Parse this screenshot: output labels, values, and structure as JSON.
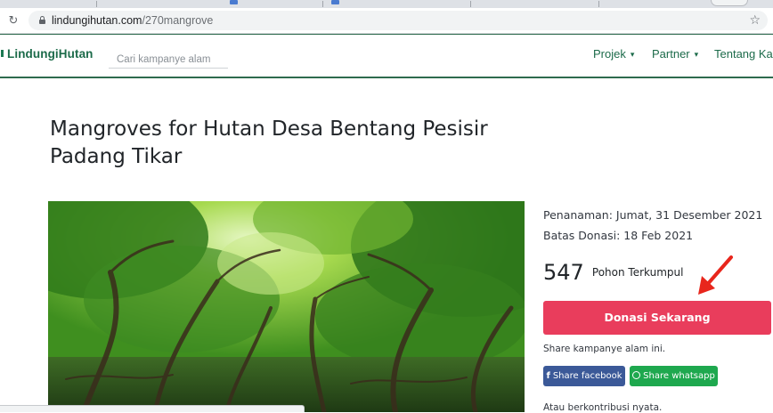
{
  "browser": {
    "url_host": "lindungihutan.com",
    "url_path": "/270mangrove",
    "reload_icon": "reload-icon",
    "bookmark_icon": "star-icon"
  },
  "header": {
    "brand": "LindungiHutan",
    "search_placeholder": "Cari kampanye alam",
    "nav": [
      {
        "label": "Projek"
      },
      {
        "label": "Partner"
      },
      {
        "label": "Tentang Kam"
      }
    ]
  },
  "campaign": {
    "title": "Mangroves for Hutan Desa Bentang Pesisir Padang Tikar",
    "planting": "Penanaman: Jumat, 31 Desember 2021",
    "deadline": "Batas Donasi: 18 Feb 2021",
    "trees_count": "547",
    "trees_label": "Pohon Terkumpul",
    "donate_button": "Donasi Sekarang",
    "share_label": "Share kampanye alam ini.",
    "share_facebook": "Share facebook",
    "share_whatsapp": "Share whatsapp",
    "contribute_label": "Atau berkontribusi nyata."
  },
  "colors": {
    "brand_green": "#1c6b4a",
    "donate_red": "#e93d5c",
    "facebook_blue": "#3b5998",
    "whatsapp_green": "#1ea84e",
    "annotation_arrow": "#e8261c"
  }
}
